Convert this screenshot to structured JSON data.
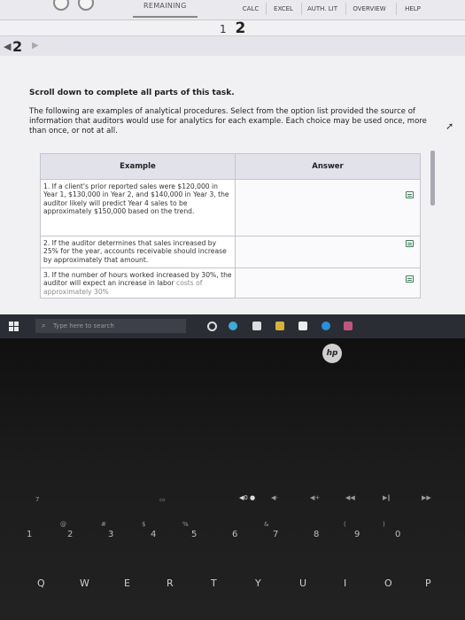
{
  "topbar": {
    "remaining_label": "REMAINING",
    "buttons": [
      {
        "label": "CALC"
      },
      {
        "label": "EXCEL"
      },
      {
        "label": "AUTH. LIT"
      },
      {
        "label": "OVERVIEW"
      },
      {
        "label": "HELP"
      }
    ]
  },
  "question_nav": {
    "prev": "1",
    "current": "2"
  },
  "pager": {
    "number": "2",
    "left_arrow": "◀",
    "right_arrow": "▶"
  },
  "task": {
    "title": "Scroll down to complete all parts of this task.",
    "intro": "The following are examples of analytical procedures. Select from the option list provided the source of information that auditors would use for analytics for each example. Each choice may be used once, more than once, or not at all."
  },
  "table": {
    "headers": {
      "example": "Example",
      "answer": "Answer"
    },
    "rows": [
      {
        "example": "1. If a client's prior reported sales were $120,000 in Year 1, $130,000 in Year 2, and $140,000 in Year 3, the auditor likely will predict Year 4 sales to be approximately $150,000 based on the trend.",
        "answer": ""
      },
      {
        "example": "2. If the auditor determines that sales increased by 25% for the year, accounts receivable should increase by approximately that amount.",
        "answer": ""
      },
      {
        "example": "3. If the number of hours worked increased by 30%, the auditor will expect an increase in labor",
        "example_faded": "costs of approximately 30%",
        "answer": ""
      }
    ]
  },
  "taskbar": {
    "search_placeholder": "Type here to search"
  },
  "laptop": {
    "brand": "hp",
    "fn_row": [
      "7",
      "▭",
      "◀0 ●",
      "◀-",
      "◀+",
      "◀◀",
      "▶‖",
      "▶▶"
    ],
    "number_row": [
      "1",
      "2",
      "3",
      "4",
      "5",
      "6",
      "7",
      "8",
      "9",
      "0"
    ],
    "number_row_symbols": [
      "@",
      "#",
      "$",
      "%",
      "&",
      "(",
      ")"
    ],
    "letter_row": [
      "Q",
      "W",
      "E",
      "R",
      "T",
      "Y",
      "U",
      "I",
      "O",
      "P"
    ]
  },
  "colors": {
    "topbar_bg": "#e9e9ee",
    "dropdown_icon": "#3d7c5c",
    "taskbar_bg": "#2a2d34"
  }
}
